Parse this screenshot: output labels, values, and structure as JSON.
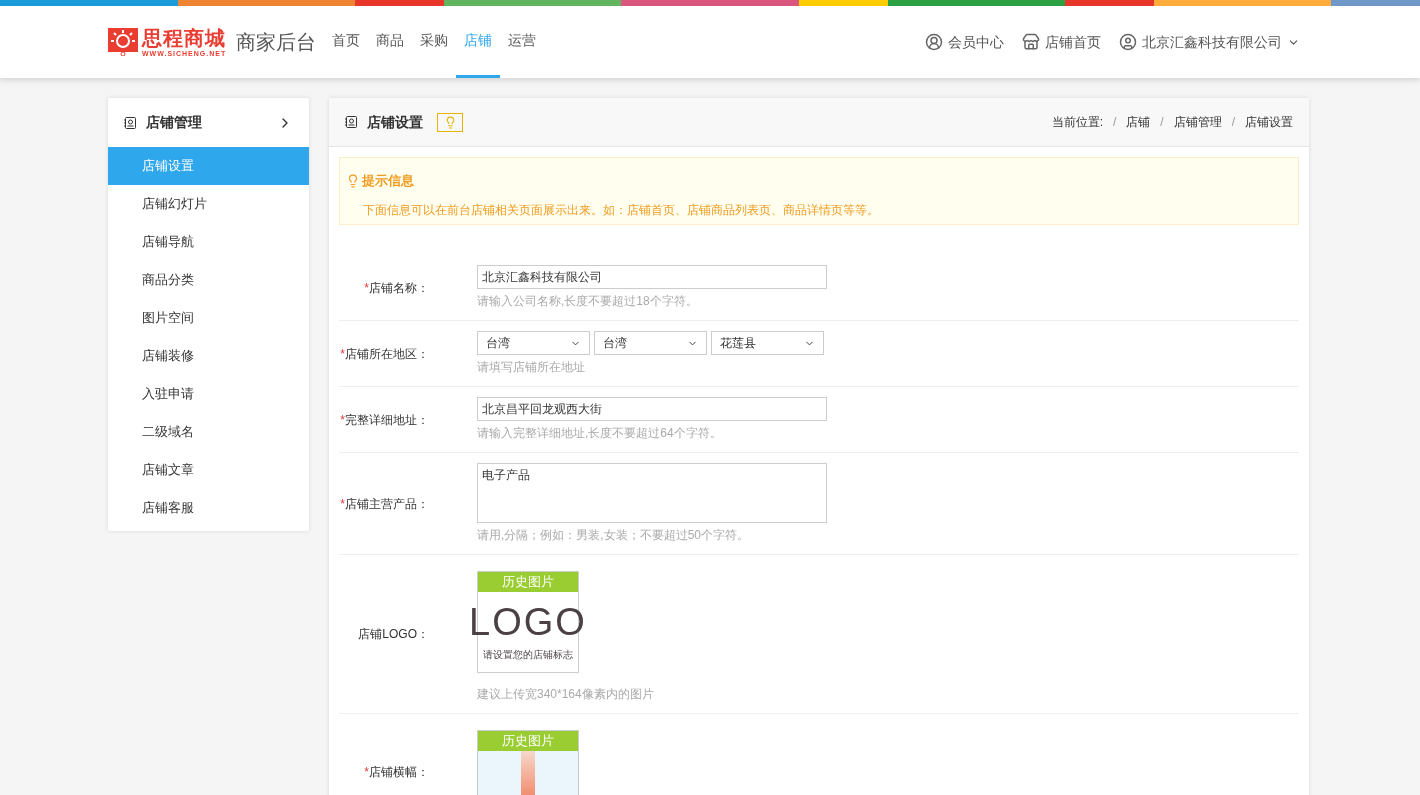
{
  "header": {
    "logo": {
      "name": "思程商城",
      "url": "WWW.SICHENG.NET"
    },
    "subtitle": "商家后台",
    "nav": [
      {
        "label": "首页",
        "selected": false
      },
      {
        "label": "商品",
        "selected": false
      },
      {
        "label": "采购",
        "selected": false
      },
      {
        "label": "店铺",
        "selected": true
      },
      {
        "label": "运营",
        "selected": false
      }
    ],
    "links": [
      {
        "kind": "member",
        "label": "会员中心"
      },
      {
        "kind": "store",
        "label": "店铺首页"
      },
      {
        "kind": "account",
        "label": "北京汇鑫科技有限公司"
      }
    ]
  },
  "sidebar": {
    "title": "店铺管理",
    "items": [
      {
        "label": "店铺设置",
        "selected": true
      },
      {
        "label": "店铺幻灯片",
        "selected": false
      },
      {
        "label": "店铺导航",
        "selected": false
      },
      {
        "label": "商品分类",
        "selected": false
      },
      {
        "label": "图片空间",
        "selected": false
      },
      {
        "label": "店铺装修",
        "selected": false
      },
      {
        "label": "入驻申请",
        "selected": false
      },
      {
        "label": "二级域名",
        "selected": false
      },
      {
        "label": "店铺文章",
        "selected": false
      },
      {
        "label": "店铺客服",
        "selected": false
      }
    ]
  },
  "main": {
    "title": "店铺设置",
    "breadcrumb": {
      "prefix": "当前位置:",
      "separator": "/",
      "items": [
        "店铺",
        "店铺管理",
        "店铺设置"
      ]
    },
    "notice": {
      "title": "提示信息",
      "text": "下面信息可以在前台店铺相关页面展示出来。如：店铺首页、店铺商品列表页、商品详情页等等。"
    },
    "form": [
      {
        "kind": "text",
        "required_mark": "*",
        "label": "店铺名称：",
        "value": "北京汇鑫科技有限公司",
        "hint": "请输入公司名称,长度不要超过18个字符。"
      },
      {
        "kind": "select",
        "required_mark": "*",
        "label": "店铺所在地区：",
        "options": [
          "台湾",
          "台湾",
          "花莲县"
        ],
        "hint": "请填写店铺所在地址"
      },
      {
        "kind": "text",
        "required_mark": "*",
        "label": "完整详细地址：",
        "value": "北京昌平回龙观西大街",
        "hint": "请输入完整详细地址,长度不要超过64个字符。"
      },
      {
        "kind": "textarea",
        "required_mark": "*",
        "label": "店铺主营产品：",
        "value": "电子产品",
        "hint": "请用,分隔；例如：男装,女装；不要超过50个字符。"
      },
      {
        "kind": "logo",
        "label": "店铺LOGO：",
        "button": "历史图片",
        "image_text": "LOGO",
        "image_subtext": "请设置您的店铺标志",
        "hint": "建议上传宽340*164像素内的图片"
      },
      {
        "kind": "banner",
        "required_mark": "*",
        "label": "店铺横幅：",
        "button": "历史图片"
      }
    ]
  }
}
